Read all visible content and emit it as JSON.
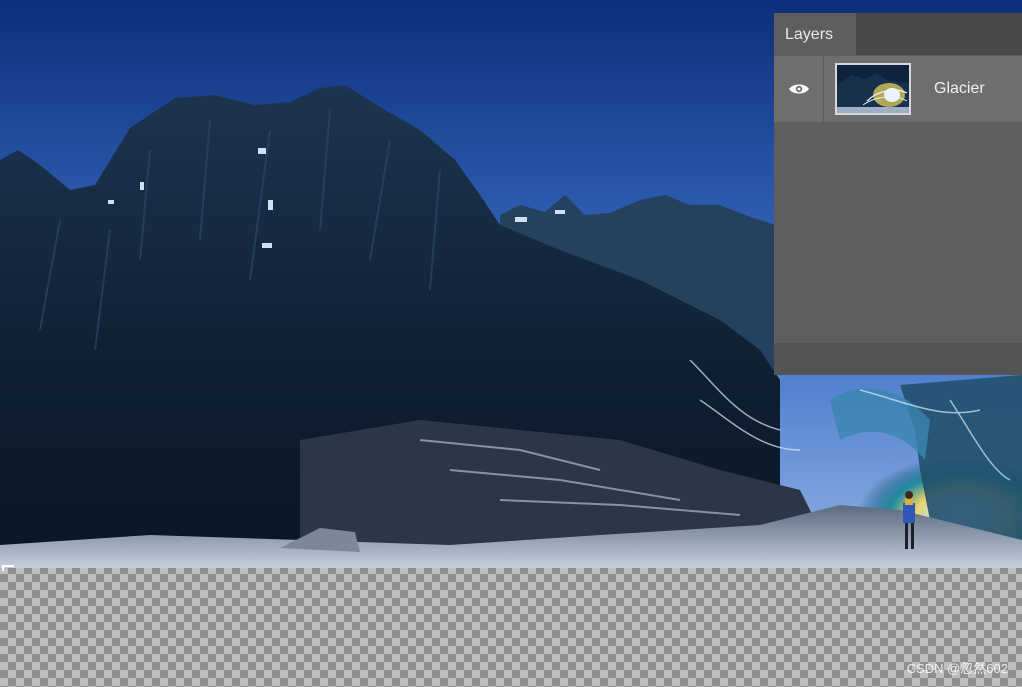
{
  "layers_panel": {
    "tab_label": "Layers",
    "layers": [
      {
        "name": "Glacier",
        "visible": true,
        "icon": "eye-icon"
      }
    ]
  },
  "canvas": {
    "transparent_area": "checkerboard"
  },
  "watermark": "CSDN @忽然602",
  "colors": {
    "panel_bg": "#5e5e5e",
    "panel_header": "#494949",
    "layer_row": "#6e6e6e",
    "sky_top": "#0b2f7a",
    "sky_bottom": "#7fa6df"
  }
}
